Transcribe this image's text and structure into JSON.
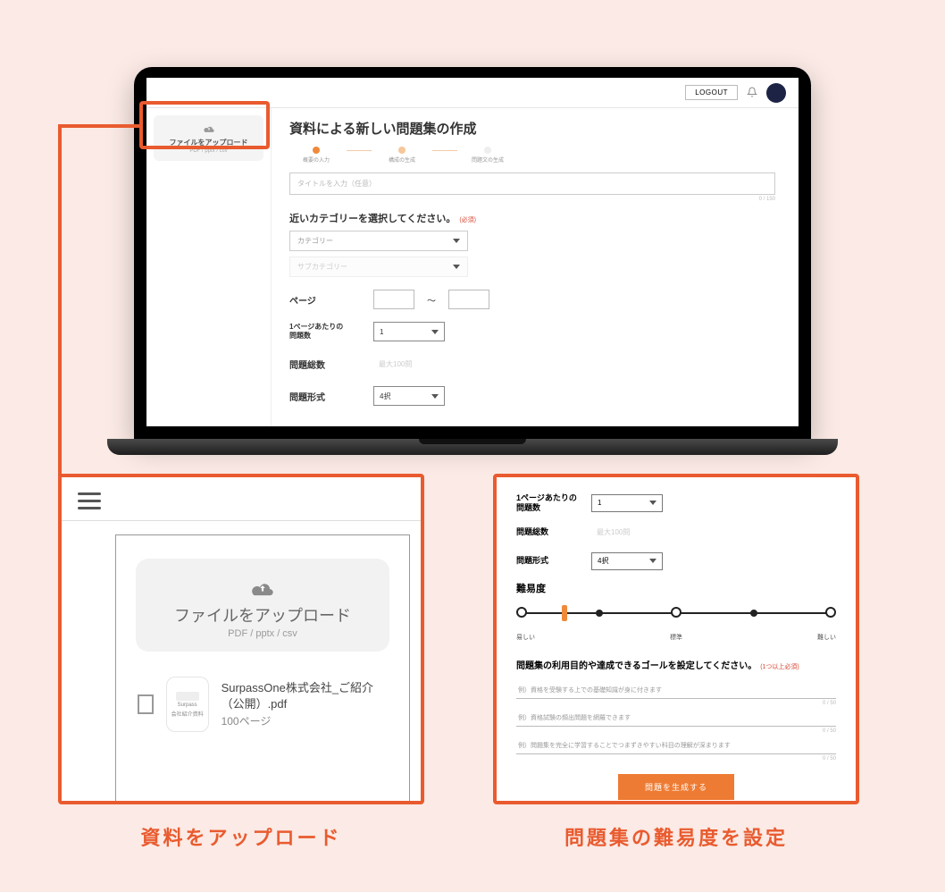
{
  "colors": {
    "accent": "#e95b2f",
    "orange": "#f08a3a"
  },
  "topbar": {
    "logout": "LOGOUT"
  },
  "sidebar_small": {
    "title": "ファイルをアップロード",
    "subtitle": "PDF / pptx / csv"
  },
  "main": {
    "title": "資料による新しい問題集の作成",
    "steps": [
      "概要の入力",
      "構成の生成",
      "問題文の生成"
    ],
    "title_input_placeholder": "タイトルを入力（任意）",
    "title_counter": "0 / 150",
    "category_heading": "近いカテゴリーを選択してください。",
    "category_required": "(必須)",
    "category_placeholder": "カテゴリー",
    "subcategory_placeholder": "サブカテゴリー",
    "page_label": "ページ",
    "page_sep": "〜",
    "per_page_label": "1ページあたりの\n問題数",
    "per_page_value": "1",
    "total_label": "問題総数",
    "total_placeholder": "最大100問",
    "format_label": "問題形式",
    "format_value": "4択"
  },
  "panel_upload": {
    "title": "ファイルをアップロード",
    "subtitle": "PDF / pptx / csv",
    "thumb_brand": "Surpass",
    "thumb_caption": "会社紹介資料",
    "file_name": "SurpassOne株式会社_ご紹介（公開）.pdf",
    "file_pages": "100ページ",
    "caption": "資料をアップロード"
  },
  "panel_difficulty": {
    "per_page_label": "1ページあたりの\n問題数",
    "per_page_value": "1",
    "total_label": "問題総数",
    "total_placeholder": "最大100問",
    "format_label": "問題形式",
    "format_value": "4択",
    "difficulty_label": "難易度",
    "scale_labels": [
      "易しい",
      "標準",
      "難しい"
    ],
    "goal_heading": "問題集の利用目的や達成できるゴールを設定してください。",
    "goal_required": "(1つ以上必須)",
    "goal_inputs": [
      "例）資格を受験する上での基礎知識が身に付きます",
      "例）資格試験の頻出問題を網羅できます",
      "例）問題集を完全に学習することでつまずきやすい科目の理解が深まります"
    ],
    "goal_counter": "0 / 50",
    "generate_button": "問題を生成する",
    "caption": "問題集の難易度を設定"
  }
}
